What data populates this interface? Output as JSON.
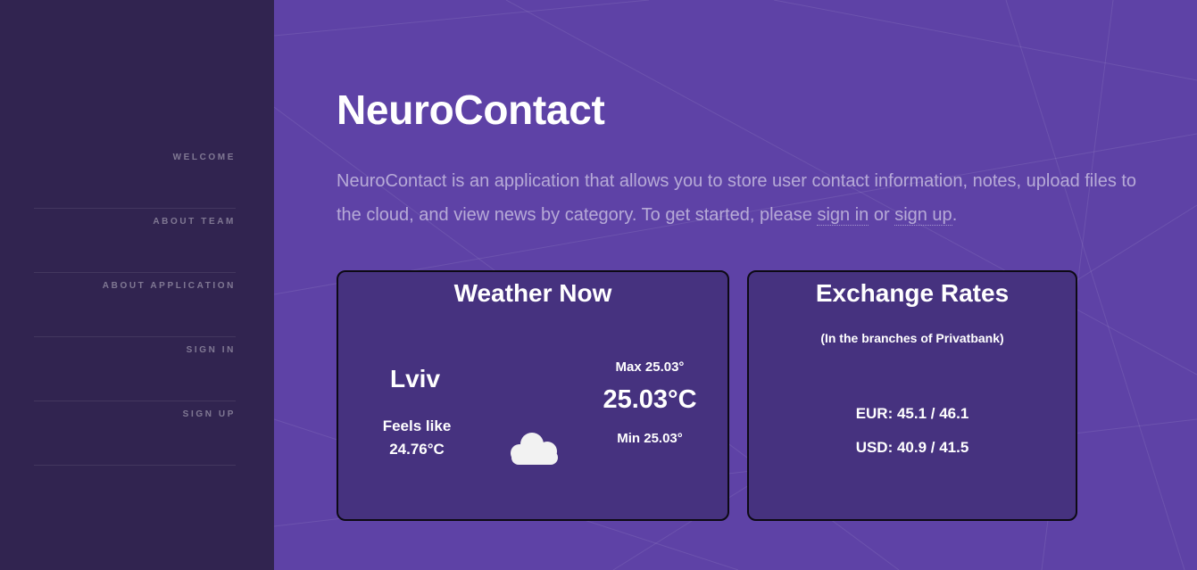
{
  "nav": {
    "items": [
      {
        "label": "WELCOME"
      },
      {
        "label": "ABOUT TEAM"
      },
      {
        "label": "ABOUT APPLICATION"
      },
      {
        "label": "SIGN IN"
      },
      {
        "label": "SIGN UP"
      }
    ]
  },
  "main": {
    "title": "NeuroContact",
    "intro_text": "NeuroContact is an application that allows you to store user contact information, notes, upload files to the cloud, and view news by category. To get started, please ",
    "sign_in_link": "sign in",
    "or_text": " or ",
    "sign_up_link": "sign up",
    "period": "."
  },
  "weather": {
    "title": "Weather Now",
    "city": "Lviv",
    "feels_label": "Feels like",
    "feels_value": "24.76°C",
    "icon": "cloud-icon",
    "max": "Max 25.03°",
    "temp": "25.03°C",
    "min": "Min 25.03°"
  },
  "rates": {
    "title": "Exchange Rates",
    "subtitle": "(In the branches of Privatbank)",
    "eur": "EUR: 45.1 / 46.1",
    "usd": "USD: 40.9 / 41.5"
  },
  "colors": {
    "sidebar_bg": "#312450",
    "main_bg": "#5e42a6",
    "card_bg": "#46327f",
    "text": "#ffffff"
  }
}
